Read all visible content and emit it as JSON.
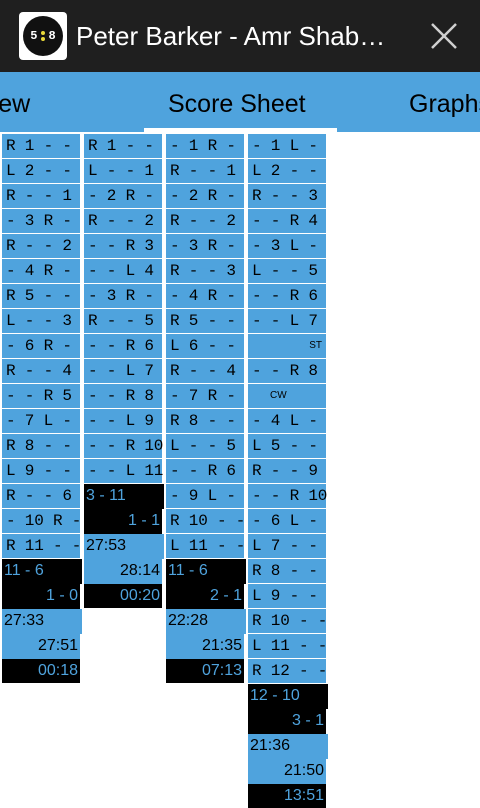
{
  "app": {
    "title": "Peter Barker - Amr Shabana",
    "icon_text": "5",
    "icon_text2": "8"
  },
  "tabs": [
    {
      "label": "Overview"
    },
    {
      "label": "Score Sheet"
    },
    {
      "label": "Graphs"
    }
  ],
  "colors": {
    "accent": "#4fa3dd",
    "bar": "#1f1f1f",
    "black": "#000000"
  },
  "games": [
    {
      "rallies": [
        "R 1 - -",
        "L 2 - -",
        "R - - 1",
        "- 3 R -",
        "R - - 2",
        "- 4 R -",
        "R 5 - -",
        "L - - 3",
        "- 6 R -",
        "R - - 4",
        "- - R 5",
        "- 7 L -",
        "R 8 - -",
        "L 9 - -",
        "R - - 6",
        "- 10 R -",
        "R 11 - -"
      ],
      "game_label": "11 - 6",
      "game_score": "1 - 0",
      "start_time": "27:33",
      "end_time": "27:51",
      "duration": "00:18"
    },
    {
      "rallies": [
        "R 1 - -",
        "L - - 1",
        "- 2 R -",
        "R - - 2",
        "- - R 3",
        "- - L 4",
        "- 3 R -",
        "R - - 5",
        "- - R 6",
        "- - L 7",
        "- - R 8",
        "- - L 9",
        "- - R 10",
        "- - L 11"
      ],
      "game_label": "3 - 11",
      "game_score": "1 - 1",
      "start_time": "27:53",
      "end_time": "28:14",
      "duration": "00:20"
    },
    {
      "rallies": [
        "- 1 R -",
        "R - - 1",
        "- 2 R -",
        "R - - 2",
        "- 3 R -",
        "R - - 3",
        "- 4 R -",
        "R 5 - -",
        "L 6 - -",
        "R - - 4",
        "- 7 R -",
        "R 8 - -",
        "L - - 5",
        "- - R 6",
        "- 9 L -",
        "R 10 - -",
        "L 11 - -"
      ],
      "game_label": "11 - 6",
      "game_score": "2 - 1",
      "start_time": "22:28",
      "end_time": "21:35",
      "duration": "07:13"
    },
    {
      "rallies": [
        "- 1 L -",
        "L 2 - -",
        "R - - 3",
        "- - R 4",
        "- 3 L -",
        "L - - 5",
        "- - R 6",
        "- - L 7",
        "",
        "- - R 8",
        "",
        "- 4 L -",
        "L 5 - -",
        "R - - 9",
        "- - R 10",
        "- 6 L -",
        "L 7 - -",
        "R 8 - -",
        "L 9 - -",
        "R 10 - -",
        "L 11 - -",
        "R 12 - -"
      ],
      "markers": {
        "st": "ST",
        "cw": "CW"
      },
      "game_label": "12 - 10",
      "game_score": "3 - 1",
      "start_time": "21:36",
      "end_time": "21:50",
      "duration": "13:51"
    }
  ]
}
